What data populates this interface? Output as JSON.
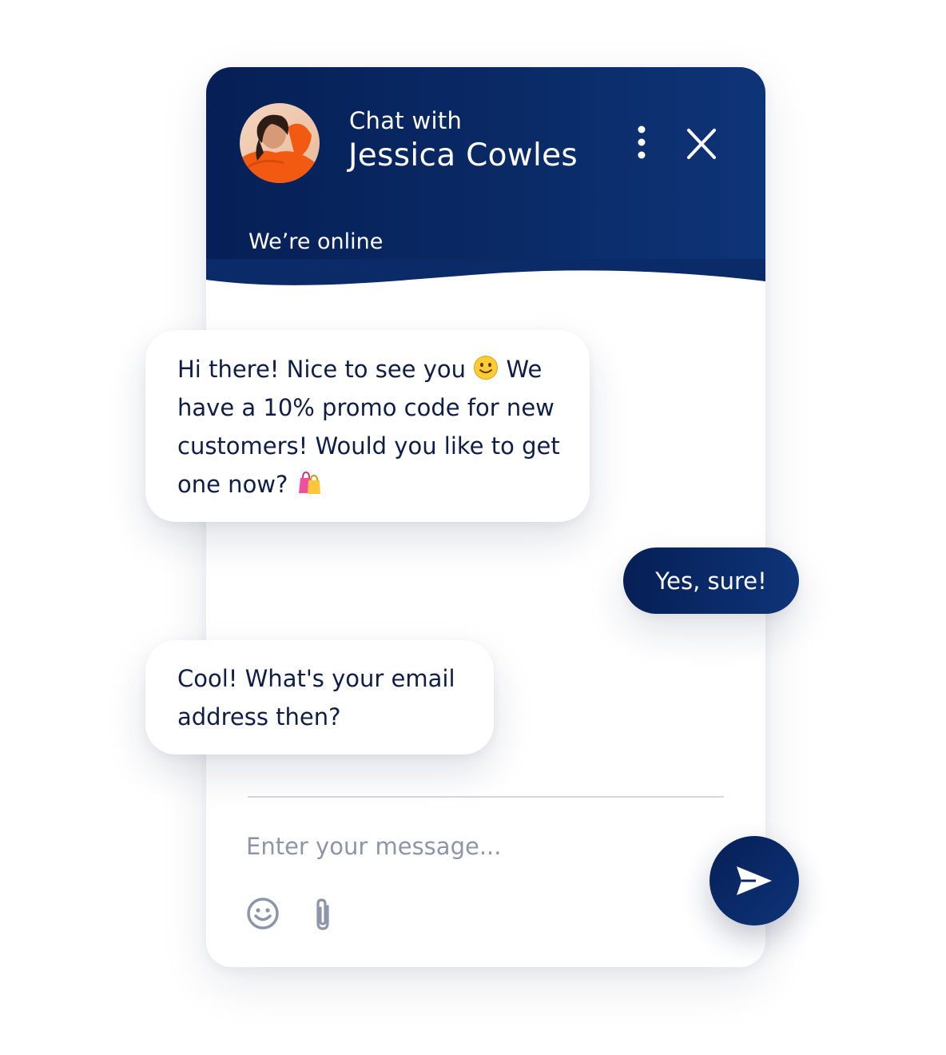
{
  "header": {
    "subtitle": "Chat with",
    "agent_name": "Jessica Cowles",
    "status": "We’re online",
    "menu_icon": "vertical-dots-icon",
    "close_icon": "close-icon"
  },
  "messages": [
    {
      "from": "agent",
      "lines": [
        "Hi there! Nice to see you",
        "We",
        "have a 10% promo code for new",
        "customers! Would you like to get",
        "one now?"
      ],
      "emojis": [
        "slightly-smiling-face",
        "shopping-bags"
      ]
    },
    {
      "from": "user",
      "text": "Yes, sure!"
    },
    {
      "from": "agent",
      "lines": [
        "Cool! What's your email",
        "address then?"
      ]
    }
  ],
  "composer": {
    "placeholder": "Enter your message...",
    "value": "",
    "emoji_icon": "smiley-icon",
    "attach_icon": "paperclip-icon",
    "send_icon": "send-icon"
  },
  "colors": {
    "brand_dark": "#061f56",
    "brand_light": "#0e3478",
    "text": "#0f1e48",
    "muted": "#8c96a8"
  }
}
